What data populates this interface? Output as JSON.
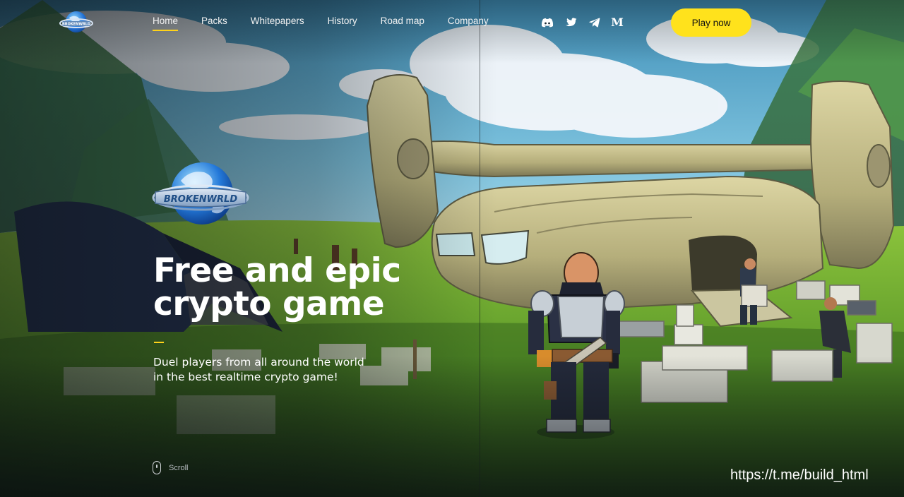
{
  "header": {
    "logo_alt": "BROKENWRLD",
    "nav": [
      {
        "label": "Home",
        "active": true
      },
      {
        "label": "Packs",
        "active": false
      },
      {
        "label": "Whitepapers",
        "active": false
      },
      {
        "label": "History",
        "active": false
      },
      {
        "label": "Road map",
        "active": false
      },
      {
        "label": "Company",
        "active": false
      }
    ],
    "socials": [
      "discord-icon",
      "twitter-icon",
      "telegram-icon",
      "medium-icon"
    ],
    "medium_glyph": "M",
    "cta_label": "Play now"
  },
  "hero": {
    "logo_text": "BROKENWRLD",
    "title_line1": "Free and epic",
    "title_line2": "crypto game",
    "subtitle_line1": "Duel players from all around the world",
    "subtitle_line2": "in the best realtime crypto game!"
  },
  "scroll": {
    "label": "Scroll"
  },
  "watermark": "https://t.me/build_html",
  "colors": {
    "accent": "#ffd21a",
    "button": "#ffe21c",
    "text": "#ffffff"
  }
}
